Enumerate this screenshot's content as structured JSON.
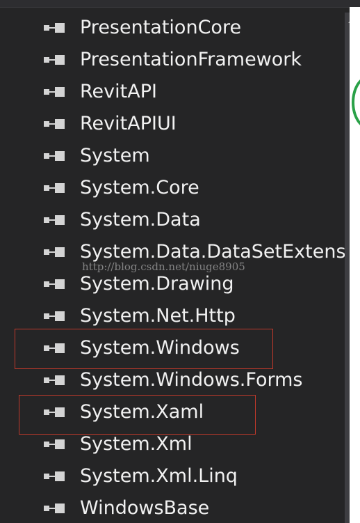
{
  "references": {
    "items": [
      {
        "label": "PresentationCore"
      },
      {
        "label": "PresentationFramework"
      },
      {
        "label": "RevitAPI"
      },
      {
        "label": "RevitAPIUI"
      },
      {
        "label": "System"
      },
      {
        "label": "System.Core"
      },
      {
        "label": "System.Data"
      },
      {
        "label": "System.Data.DataSetExtens"
      },
      {
        "label": "System.Drawing"
      },
      {
        "label": "System.Net.Http"
      },
      {
        "label": "System.Windows"
      },
      {
        "label": "System.Windows.Forms"
      },
      {
        "label": "System.Xaml"
      },
      {
        "label": "System.Xml"
      },
      {
        "label": "System.Xml.Linq"
      },
      {
        "label": "WindowsBase"
      }
    ],
    "icon": "assembly-reference-icon"
  },
  "watermark": "http://blog.csdn.net/niuge8905",
  "colors": {
    "background": "#252526",
    "text": "#f1f1f1",
    "highlight_border": "#c0392b",
    "scrollbar": "#3e3e42",
    "circle_accent": "#2aa148"
  }
}
